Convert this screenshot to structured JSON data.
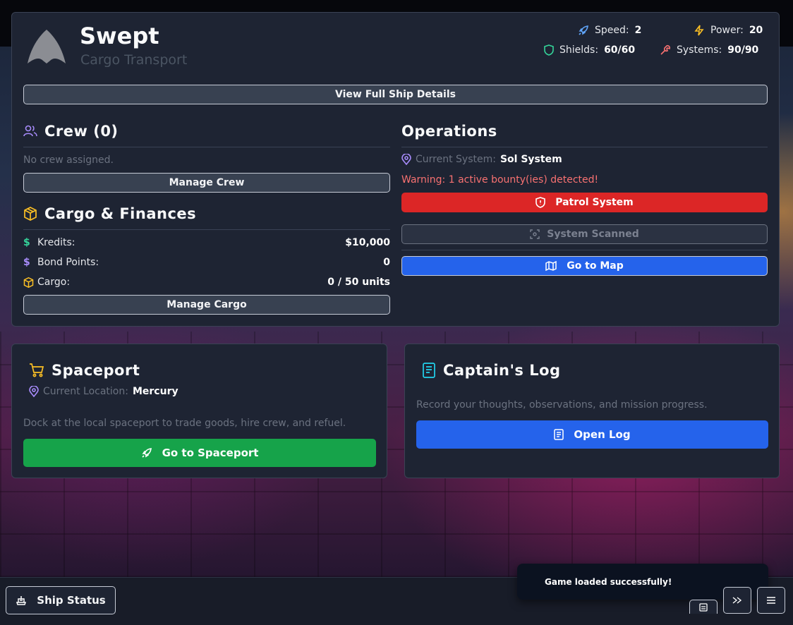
{
  "ship": {
    "name": "Swept",
    "class": "Cargo Transport",
    "stats": {
      "speed_label": "Speed:",
      "speed_value": "2",
      "power_label": "Power:",
      "power_value": "20",
      "shields_label": "Shields:",
      "shields_value": "60/60",
      "systems_label": "Systems:",
      "systems_value": "90/90"
    },
    "details_button": "View Full Ship Details"
  },
  "crew": {
    "title": "Crew (0)",
    "empty_text": "No crew assigned.",
    "manage_button": "Manage Crew"
  },
  "cargo": {
    "title": "Cargo & Finances",
    "rows": [
      {
        "label": "Kredits:",
        "value": "$10,000"
      },
      {
        "label": "Bond Points:",
        "value": "0"
      },
      {
        "label": "Cargo:",
        "value": "0 / 50 units"
      }
    ],
    "manage_button": "Manage Cargo"
  },
  "operations": {
    "title": "Operations",
    "current_system_label": "Current System:",
    "current_system_value": "Sol System",
    "warning": "Warning: 1 active bounty(ies) detected!",
    "patrol_button": "Patrol System",
    "scanned_button": "System Scanned",
    "map_button": "Go to Map"
  },
  "spaceport": {
    "title": "Spaceport",
    "location_label": "Current Location:",
    "location_value": "Mercury",
    "description": "Dock at the local spaceport to trade goods, hire crew, and refuel.",
    "button": "Go to Spaceport"
  },
  "log": {
    "title": "Captain's Log",
    "description": "Record your thoughts, observations, and mission progress.",
    "button": "Open Log"
  },
  "bottom_bar": {
    "ship_status_button": "Ship Status",
    "toast": "Game loaded successfully!"
  },
  "colors": {
    "panel": "#1e2433",
    "danger": "#dc2626",
    "primary": "#2563eb",
    "success": "#16a34a",
    "warning_text": "#f87171",
    "accent_purple": "#a78bfa",
    "accent_yellow": "#fbbf24"
  }
}
